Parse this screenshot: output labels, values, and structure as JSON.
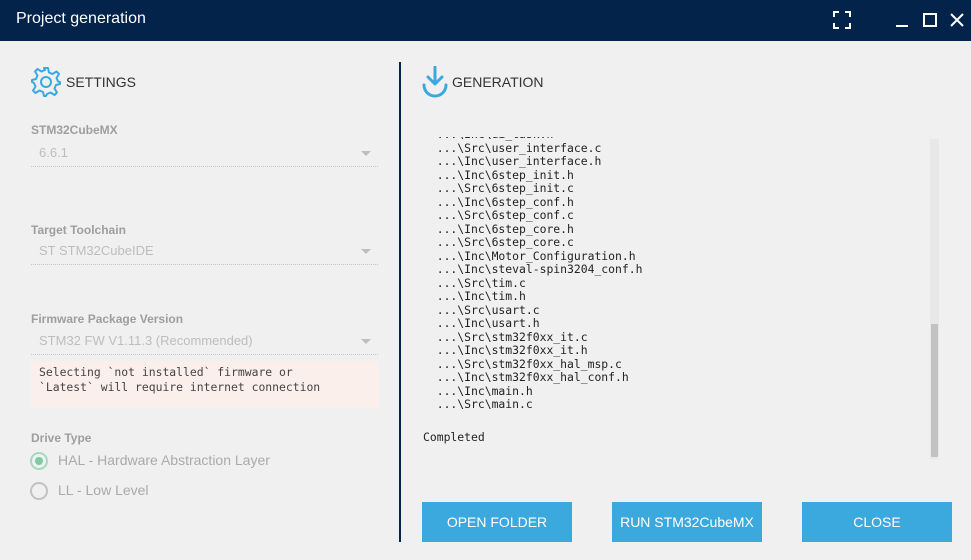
{
  "window": {
    "title": "Project generation"
  },
  "settings": {
    "header": "SETTINGS",
    "cubemx": {
      "label": "STM32CubeMX",
      "value": "6.6.1"
    },
    "toolchain": {
      "label": "Target Toolchain",
      "value": "ST STM32CubeIDE"
    },
    "firmware": {
      "label": "Firmware Package Version",
      "value": "STM32 FW V1.11.3 (Recommended)",
      "warning_line1": "Selecting `not installed` firmware or",
      "warning_line2": "`Latest` will require internet connection"
    },
    "drive_type": {
      "label": "Drive Type",
      "options": [
        {
          "label": "HAL - Hardware Abstraction Layer",
          "selected": true
        },
        {
          "label": "LL - Low Level",
          "selected": false
        }
      ]
    }
  },
  "generation": {
    "header": "GENERATION",
    "log": [
      "  ...\\Inc\\ui_task.h",
      "  ...\\Src\\user_interface.c",
      "  ...\\Inc\\user_interface.h",
      "  ...\\Inc\\6step_init.h",
      "  ...\\Src\\6step_init.c",
      "  ...\\Inc\\6step_conf.h",
      "  ...\\Src\\6step_conf.c",
      "  ...\\Inc\\6step_core.h",
      "  ...\\Src\\6step_core.c",
      "  ...\\Inc\\Motor_Configuration.h",
      "  ...\\Inc\\steval-spin3204_conf.h",
      "  ...\\Src\\tim.c",
      "  ...\\Inc\\tim.h",
      "  ...\\Src\\usart.c",
      "  ...\\Inc\\usart.h",
      "  ...\\Src\\stm32f0xx_it.c",
      "  ...\\Inc\\stm32f0xx_it.h",
      "  ...\\Src\\stm32f0xx_hal_msp.c",
      "  ...\\Inc\\stm32f0xx_hal_conf.h",
      "  ...\\Inc\\main.h",
      "  ...\\Src\\main.c"
    ],
    "status": "Completed"
  },
  "buttons": {
    "open_folder": "OPEN FOLDER",
    "run_cubemx": "RUN STM32CubeMX",
    "close": "CLOSE"
  },
  "colors": {
    "title_bar": "#03234b",
    "accent": "#3ba9de",
    "radio_checked": "#7fcaa3",
    "warning_bg": "#fbefec"
  }
}
